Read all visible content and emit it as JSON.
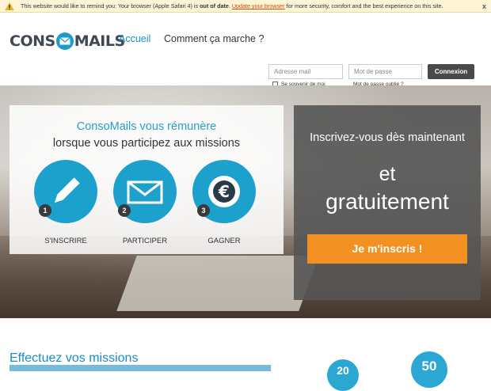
{
  "notice": {
    "text_before": "This website would like to remind you: Your browser (Apple Safari 4) is ",
    "bold": "out of date",
    "text_mid": ". ",
    "link": "Update your browser",
    "text_after": " for more security, comfort and the best experience on this site.",
    "close": "x"
  },
  "header": {
    "logo_left": "CONS",
    "logo_right": "MAILS",
    "nav": [
      "Accueil",
      "Comment ça marche ?"
    ],
    "login": {
      "email_placeholder": "Adresse mail",
      "password_placeholder": "Mot de passe",
      "button": "Connexion",
      "remember": "Se souvenir de moi",
      "forgot": "Mot de passe oublié ?"
    }
  },
  "hero": {
    "panel": {
      "line1": "ConsoMails vous rémunère",
      "line2": "lorsque vous participez aux missions",
      "steps": [
        {
          "num": "1",
          "label": "S'INSCRIRE",
          "icon": "pencil-icon"
        },
        {
          "num": "2",
          "label": "PARTICIPER",
          "icon": "envelope-icon"
        },
        {
          "num": "3",
          "label": "GAGNER",
          "icon": "euro-icon"
        }
      ]
    },
    "signup": {
      "line1": "Inscrivez-vous dès maintenant",
      "line2": "et",
      "line3": "gratuitement",
      "button": "Je m'inscris !"
    }
  },
  "bottom": {
    "heading": "Effectuez vos missions",
    "badge1": "20",
    "badge2": "50"
  },
  "colors": {
    "accent_blue": "#1ca0cc",
    "orange": "#f29121",
    "dark_panel": "#555555"
  }
}
